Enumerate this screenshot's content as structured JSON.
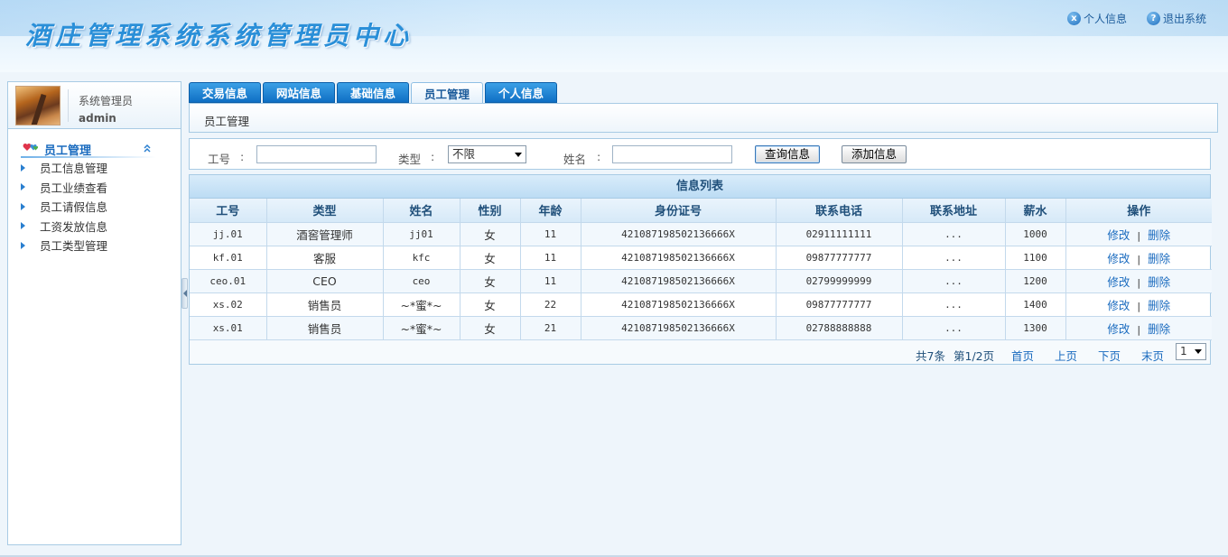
{
  "header": {
    "title": "酒庄管理系统系统管理员中心",
    "links": [
      {
        "label": "个人信息",
        "icon": "x-circle-icon",
        "glyph": "x"
      },
      {
        "label": "退出系统",
        "icon": "help-circle-icon",
        "glyph": "?"
      }
    ]
  },
  "sidebar": {
    "user": {
      "role": "系统管理员",
      "name": "admin"
    },
    "menu_title": "员工管理",
    "collapse_glyph": "⌃",
    "items": [
      {
        "label": "员工信息管理"
      },
      {
        "label": "员工业绩查看"
      },
      {
        "label": "员工请假信息"
      },
      {
        "label": "工资发放信息"
      },
      {
        "label": "员工类型管理"
      }
    ]
  },
  "tabs": [
    {
      "label": "交易信息",
      "active": false
    },
    {
      "label": "网站信息",
      "active": false
    },
    {
      "label": "基础信息",
      "active": false
    },
    {
      "label": "员工管理",
      "active": true
    },
    {
      "label": "个人信息",
      "active": false
    }
  ],
  "breadcrumb": "员工管理",
  "search": {
    "id_label": "工号",
    "type_label": "类型",
    "name_label": "姓名",
    "colon": ":",
    "id_value": "",
    "type_value": "不限",
    "name_value": "",
    "query_button": "查询信息",
    "add_button": "添加信息"
  },
  "table": {
    "caption": "信息列表",
    "columns": [
      "工号",
      "类型",
      "姓名",
      "性别",
      "年龄",
      "身份证号",
      "联系电话",
      "联系地址",
      "薪水",
      "操作"
    ],
    "rows": [
      {
        "id": "jj.01",
        "type": "酒窖管理师",
        "name": "jj01",
        "gender": "女",
        "age": "11",
        "idcard": "421087198502136666X",
        "phone": "02911111111",
        "address": "...",
        "salary": "1000"
      },
      {
        "id": "kf.01",
        "type": "客服",
        "name": "kfc",
        "gender": "女",
        "age": "11",
        "idcard": "421087198502136666X",
        "phone": "09877777777",
        "address": "...",
        "salary": "1100"
      },
      {
        "id": "ceo.01",
        "type": "CEO",
        "name": "ceo",
        "gender": "女",
        "age": "11",
        "idcard": "421087198502136666X",
        "phone": "02799999999",
        "address": "...",
        "salary": "1200"
      },
      {
        "id": "xs.02",
        "type": "销售员",
        "name": "~*蜜*~",
        "gender": "女",
        "age": "22",
        "idcard": "421087198502136666X",
        "phone": "09877777777",
        "address": "...",
        "salary": "1400"
      },
      {
        "id": "xs.01",
        "type": "销售员",
        "name": "~*蜜*~",
        "gender": "女",
        "age": "21",
        "idcard": "421087198502136666X",
        "phone": "02788888888",
        "address": "...",
        "salary": "1300"
      }
    ],
    "edit_label": "修改",
    "separator": "|",
    "delete_label": "删除"
  },
  "pager": {
    "total": "共7条",
    "page": "第1/2页",
    "first": "首页",
    "prev": "上页",
    "next": "下页",
    "last": "末页",
    "select_value": "1"
  },
  "colors": {
    "accent": "#1a6bbf",
    "tab_blue": "#0f6fc4",
    "border": "#a8cbe4",
    "header_bg": "#cfe8fb"
  }
}
